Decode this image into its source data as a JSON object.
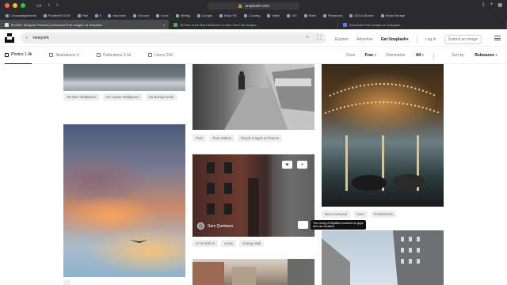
{
  "browser": {
    "url": "unsplash.com",
    "bookmarks": [
      "Crossassignments",
      "Poultrieft7.0000",
      "Rail",
      "ℹ",
      "Automise",
      "Chrome",
      "Linux",
      "Writing",
      "Google",
      "Brian RC",
      "Country",
      "Vitals",
      "100",
      "Ratio",
      "Pinearena",
      "SDI & Movies",
      "Nona Storage"
    ],
    "tabs": [
      {
        "label": "50,000+ Newyork Pictures | Download Free Images on Unsplash",
        "active": true
      },
      {
        "label": "50 Pics of the Best Welcome to New York City Images...",
        "active": false
      },
      {
        "label": "Download Free Images on Unsplash",
        "active": false
      }
    ]
  },
  "header": {
    "search_value": "newyork",
    "nav": [
      "Explore",
      "Advertise"
    ],
    "cta": "Get Unsplash+",
    "login": "Log in",
    "submit": "Submit an image"
  },
  "filters": {
    "tabs": [
      {
        "label": "Photos 1.4k",
        "active": true
      },
      {
        "label": "Illustrations 0",
        "active": false
      },
      {
        "label": "Collections 3.1k",
        "active": false
      },
      {
        "label": "Users 243",
        "active": false
      }
    ],
    "clear": "Clear",
    "license": "Free",
    "orientation_label": "Orientation",
    "orientation_value": "All",
    "sort_label": "Sort by",
    "sort_value": "Relevance"
  },
  "photos": {
    "col1_tags": [
      "HD Blue Wallpapers",
      "HD Laptop Wallpapers",
      "HD Backgrounds"
    ],
    "col2_tags": [
      "Train",
      "Train Station",
      "People Images & Pictures"
    ],
    "col2b_tags": [
      "47 W 20th St",
      "Union",
      "Orange Wall"
    ],
    "col3_tags": [
      "Neon Carousel",
      "Cave",
      "#ArtistsCircle"
    ],
    "author": "Sam Quintana",
    "tooltip": "Turn hiring of Nightline someone sc-guys all to an occasion"
  },
  "colors": {
    "chrome_bg": "#2b2b2d",
    "search_bg": "#eeeeee",
    "tag_bg": "#eeeeee"
  }
}
